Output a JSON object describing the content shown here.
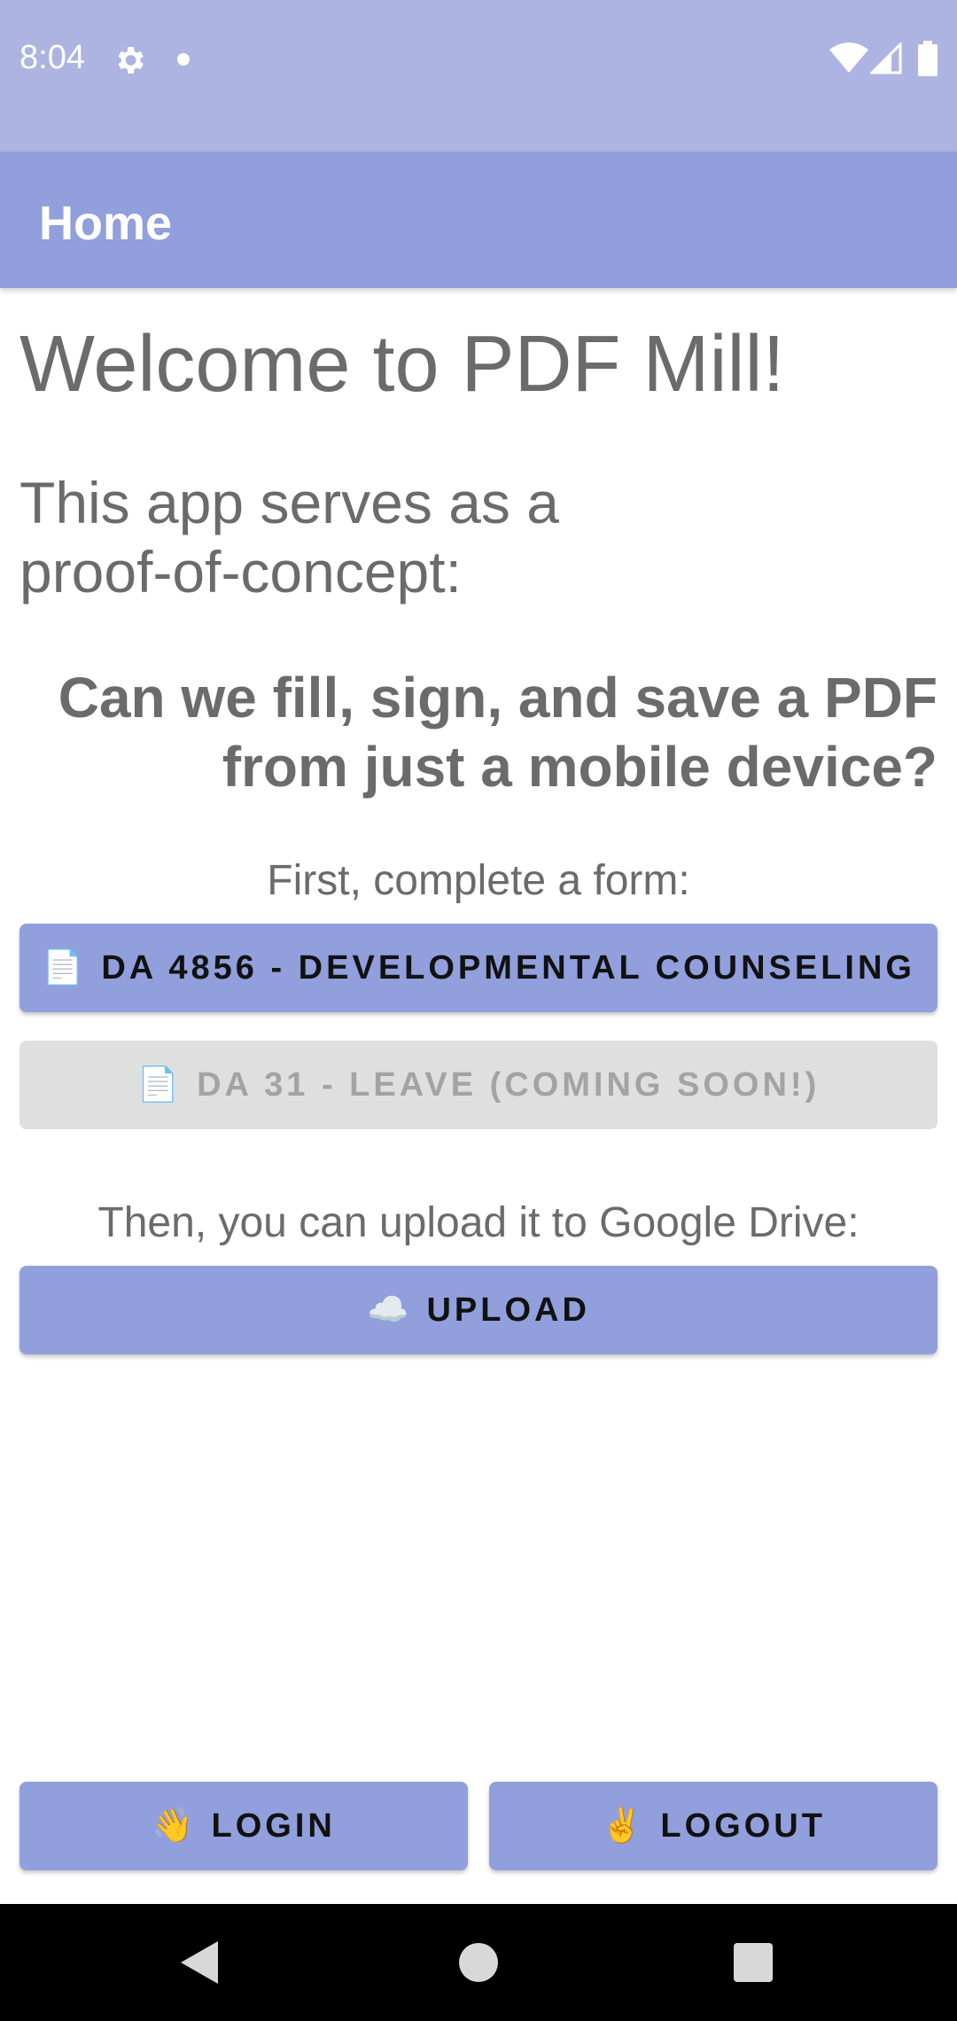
{
  "status_bar": {
    "time": "8:04"
  },
  "app_bar": {
    "title": "Home"
  },
  "main": {
    "welcome": "Welcome to PDF Mill!",
    "intro": "This app serves as a proof-of-concept:",
    "question": "Can we fill, sign, and save a PDF from just a mobile device?",
    "form_prompt": "First, complete a form:",
    "form_buttons": [
      {
        "emoji": "📄",
        "label": "DA 4856 - DEVELOPMENTAL COUNSELING",
        "enabled": true
      },
      {
        "emoji": "📄",
        "label": "DA 31 - LEAVE (COMING SOON!)",
        "enabled": false
      }
    ],
    "upload_prompt": "Then, you can upload it to Google Drive:",
    "upload_button": {
      "emoji": "☁️",
      "label": "UPLOAD"
    }
  },
  "footer": {
    "login": {
      "emoji": "👋",
      "label": "LOGIN"
    },
    "logout": {
      "emoji": "✌️",
      "label": "LOGOUT"
    }
  },
  "colors": {
    "status_bar": "#adb4e2",
    "app_bar": "#929fdd",
    "button": "#929fdd",
    "disabled_button": "#dfdfdf",
    "text_gray": "#6b6b6b"
  }
}
